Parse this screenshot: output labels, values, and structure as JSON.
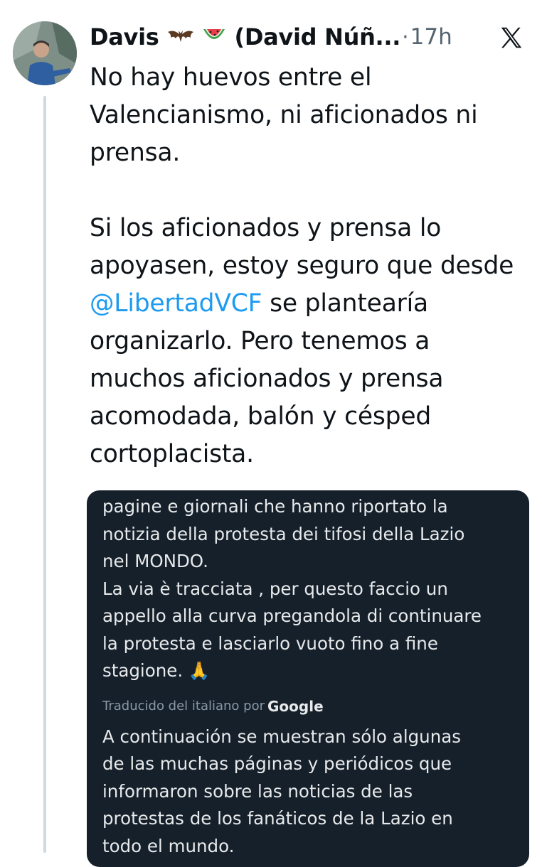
{
  "tweet": {
    "author_name": "Davis",
    "author_emojis": [
      "bat",
      "watermelon"
    ],
    "author_handle_truncated": "(David Núñ...",
    "separator": "·",
    "time": "17h",
    "platform_icon": "x-logo-icon",
    "text_lines_p1": [
      "No hay huevos entre el",
      "Valencianismo, ni aficionados ni",
      "prensa."
    ],
    "text_p2_line1": "Si los aficionados y prensa lo",
    "text_p2_line2": "apoyasen, estoy seguro que desde",
    "mention": "@LibertadVCF",
    "text_p2_after_mention": " se plantearía",
    "text_p2_rest": [
      "organizarlo. Pero tenemos a",
      "muchos aficionados y prensa",
      "acomodada, balón y césped",
      "cortoplacista."
    ]
  },
  "quoted_card": {
    "original_lines": [
      "pagine e giornali che hanno riportato la",
      "notizia della protesta dei tifosi della Lazio",
      "nel MONDO.",
      "La via è tracciata , per questo faccio un",
      "appello alla curva pregandola di continuare",
      "la protesta e lasciarlo vuoto fino a fine",
      "stagione. 🙏"
    ],
    "translated_by_label": "Traducido del italiano por",
    "translated_by_brand": "Google",
    "translated_lines": [
      "A continuación se muestran sólo algunas",
      "de las muchas páginas y periódicos que",
      "informaron sobre las noticias de las",
      "protestas de los fanáticos de la Lazio en",
      "todo el mundo."
    ]
  },
  "colors": {
    "mention": "#1d9bf0",
    "card_background": "#15202b",
    "secondary_text": "#536471"
  }
}
